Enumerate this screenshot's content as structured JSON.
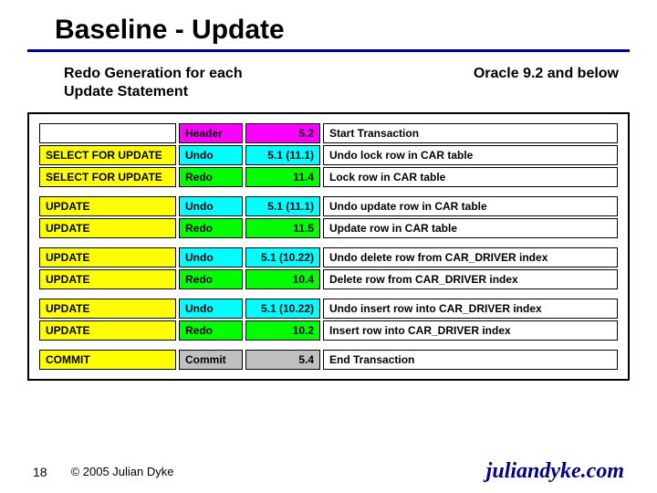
{
  "title": "Baseline - Update",
  "subtitle_left": "Redo Generation for each\nUpdate Statement",
  "subtitle_right": "Oracle 9.2 and below",
  "rows": [
    {
      "left": "",
      "type": "Header",
      "value": "5.2",
      "desc": "Start Transaction",
      "color": "magenta"
    },
    {
      "left": "SELECT FOR UPDATE",
      "type": "Undo",
      "value": "5.1 (11.1)",
      "desc": "Undo lock row in CAR table",
      "color": "cyan"
    },
    {
      "left": "SELECT FOR UPDATE",
      "type": "Redo",
      "value": "11.4",
      "desc": "Lock row in CAR table",
      "color": "green"
    },
    {
      "spacer": true
    },
    {
      "left": "UPDATE",
      "type": "Undo",
      "value": "5.1 (11.1)",
      "desc": "Undo update row in CAR table",
      "color": "cyan"
    },
    {
      "left": "UPDATE",
      "type": "Redo",
      "value": "11.5",
      "desc": "Update row in CAR table",
      "color": "green"
    },
    {
      "spacer": true
    },
    {
      "left": "UPDATE",
      "type": "Undo",
      "value": "5.1 (10.22)",
      "desc": "Undo delete row from CAR_DRIVER index",
      "color": "cyan"
    },
    {
      "left": "UPDATE",
      "type": "Redo",
      "value": "10.4",
      "desc": "Delete row from CAR_DRIVER index",
      "color": "green"
    },
    {
      "spacer": true
    },
    {
      "left": "UPDATE",
      "type": "Undo",
      "value": "5.1 (10.22)",
      "desc": "Undo insert row into CAR_DRIVER index",
      "color": "cyan"
    },
    {
      "left": "UPDATE",
      "type": "Redo",
      "value": "10.2",
      "desc": "Insert row into CAR_DRIVER index",
      "color": "green"
    },
    {
      "spacer": true
    },
    {
      "left": "COMMIT",
      "type": "Commit",
      "value": "5.4",
      "desc": "End Transaction",
      "color": "gray"
    }
  ],
  "page_number": "18",
  "copyright": "© 2005 Julian Dyke",
  "domain_text": "juliandyke.com"
}
